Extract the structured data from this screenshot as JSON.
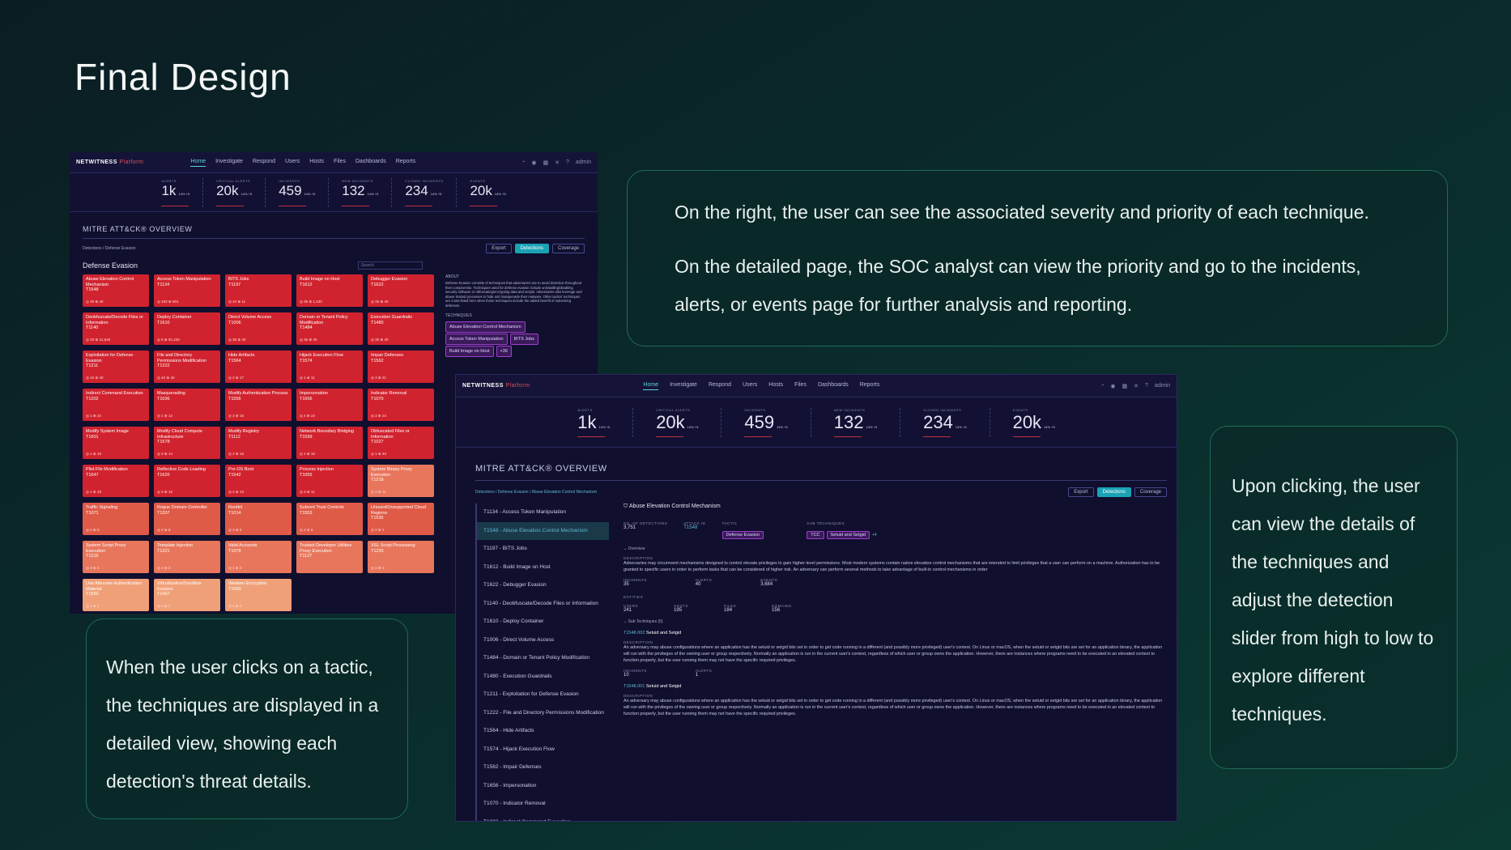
{
  "slide": {
    "title": "Final Design",
    "note_top_right": {
      "p1": "On the right, the user can see the associated severity and priority of each technique.",
      "p2": "On the detailed page, the SOC analyst can view the priority and go to the incidents, alerts, or events page for further analysis and reporting."
    },
    "note_bottom_left": "When the user clicks on a tactic, the techniques are displayed in a detailed view, showing each detection's threat details.",
    "note_right": "Upon clicking, the user can view the details of the techniques and adjust the detection slider from high to low to explore different techniques."
  },
  "app": {
    "logo": "NETWITNESS",
    "platform": "Platform",
    "nav": [
      "Home",
      "Investigate",
      "Respond",
      "Users",
      "Hosts",
      "Files",
      "Dashboards",
      "Reports"
    ],
    "user": "admin",
    "stats": [
      {
        "label": "ALERTS",
        "value": "1k",
        "delta": "14% +5"
      },
      {
        "label": "CRITICAL ALERTS",
        "value": "20k",
        "delta": "14% +5"
      },
      {
        "label": "INCIDENTS",
        "value": "459",
        "delta": "14% +5"
      },
      {
        "label": "NEW INCIDENTS",
        "value": "132",
        "delta": "14% +5"
      },
      {
        "label": "CLOSED INCIDENTS",
        "value": "234",
        "delta": "14% +5"
      },
      {
        "label": "EVENTS",
        "value": "20k",
        "delta": "14% +5"
      }
    ],
    "section_title": "MITRE ATT&CK® OVERVIEW",
    "export": "Export",
    "detections": "Detections",
    "coverage": "Coverage"
  },
  "screen1": {
    "breadcrumb": "Detections / Defense Evasion",
    "heading": "Defense Evasion",
    "search_placeholder": "Search",
    "about_label": "ABOUT",
    "about_text": "Defense Evasion consists of techniques that adversaries use to avoid detection throughout their compromise. Techniques used for defense evasion include uninstalling/disabling security software or obfuscating/encrypting data and scripts. Adversaries also leverage and abuse trusted processes to hide and masquerade their malware. Other tactics' techniques are cross-listed here when those techniques include the added benefit of subverting defenses.",
    "techniques_label": "TECHNIQUES",
    "technique_tags": [
      "Abuse Elevation Control Mechanism",
      "Access Token Manipulation",
      "BITS Jobs",
      "Build Image on Host",
      "+39"
    ],
    "cells": [
      {
        "name": "Abuse Elevation Control Mechanism",
        "id": "T1548",
        "m": "◎ 35 ⊕ 40",
        "c": "r1"
      },
      {
        "name": "Access Token Manipulation",
        "id": "T1134",
        "m": "◎ 183 ⊕ 501",
        "c": "r1"
      },
      {
        "name": "BITS Jobs",
        "id": "T1197",
        "m": "◎ 42 ⊕ 11",
        "c": "r1"
      },
      {
        "name": "Build Image on Host",
        "id": "T1612",
        "m": "◎ 35 ⊕ 1,430",
        "c": "r1"
      },
      {
        "name": "Debugger Evasion",
        "id": "T1622",
        "m": "◎ 35 ⊕ 40",
        "c": "r1"
      },
      {
        "name": "Deobfuscate/Decode Files or Information",
        "id": "T1140",
        "m": "◎ 20 ⊕ 12,640",
        "c": "r1"
      },
      {
        "name": "Deploy Container",
        "id": "T1610",
        "m": "◎ 5 ⊕ 91,240",
        "c": "r1"
      },
      {
        "name": "Direct Volume Access",
        "id": "T1006",
        "m": "◎ 35 ⊕ 40",
        "c": "r1"
      },
      {
        "name": "Domain or Tenant Policy Modification",
        "id": "T1484",
        "m": "◎ 35 ⊕ 40",
        "c": "r1"
      },
      {
        "name": "Execution Guardrails",
        "id": "T1480",
        "m": "◎ 35 ⊕ 40",
        "c": "r1"
      },
      {
        "name": "Exploitation for Defense Evasion",
        "id": "T1211",
        "m": "◎ 15 ⊕ 40",
        "c": "r1"
      },
      {
        "name": "File and Directory Permissions Modification",
        "id": "T1222",
        "m": "◎ 42 ⊕ 40",
        "c": "r1"
      },
      {
        "name": "Hide Artifacts",
        "id": "T1564",
        "m": "◎ 2 ⊕ 17",
        "c": "r1"
      },
      {
        "name": "Hijack Execution Flow",
        "id": "T1574",
        "m": "◎ 1 ⊕ 11",
        "c": "r1"
      },
      {
        "name": "Impair Defenses",
        "id": "T1562",
        "m": "◎ 3 ⊕ 21",
        "c": "r1"
      },
      {
        "name": "Indirect Command Execution",
        "id": "T1202",
        "m": "◎ 1 ⊕ 24",
        "c": "r1"
      },
      {
        "name": "Masquerading",
        "id": "T1036",
        "m": "◎ 1 ⊕ 12",
        "c": "r1"
      },
      {
        "name": "Modify Authentication Process",
        "id": "T1556",
        "m": "◎ 3 ⊕ 16",
        "c": "r1"
      },
      {
        "name": "Impersonation",
        "id": "T1656",
        "m": "◎ 4 ⊕ 22",
        "c": "r1"
      },
      {
        "name": "Indicator Removal",
        "id": "T1070",
        "m": "◎ 3 ⊕ 24",
        "c": "r1"
      },
      {
        "name": "Modify System Image",
        "id": "T1601",
        "m": "◎ 1 ⊕ 16",
        "c": "r1"
      },
      {
        "name": "Modify Cloud Compute Infrastructure",
        "id": "T1578",
        "m": "◎ 3 ⊕ 14",
        "c": "r1"
      },
      {
        "name": "Modify Registry",
        "id": "T1112",
        "m": "◎ 2 ⊕ 15",
        "c": "r1"
      },
      {
        "name": "Network Boundary Bridging",
        "id": "T1599",
        "m": "◎ 1 ⊕ 10",
        "c": "r1"
      },
      {
        "name": "Obfuscated Files or Information",
        "id": "T1027",
        "m": "◎ 1 ⊕ 40",
        "c": "r1"
      },
      {
        "name": "Plist File Modification",
        "id": "T1647",
        "m": "◎ 1 ⊕ 18",
        "c": "r1"
      },
      {
        "name": "Reflective Code Loading",
        "id": "T1620",
        "m": "◎ 3 ⊕ 16",
        "c": "r1"
      },
      {
        "name": "Pre-OS Boot",
        "id": "T1542",
        "m": "◎ 2 ⊕ 13",
        "c": "r1"
      },
      {
        "name": "Process Injection",
        "id": "T1055",
        "m": "◎ 3 ⊕ 11",
        "c": "r1"
      },
      {
        "name": "System Binary Proxy Execution",
        "id": "T1218",
        "m": "◎ 3 ⊕ 11",
        "c": "r4"
      },
      {
        "name": "Traffic Signaling",
        "id": "T1071",
        "m": "◎ 2 ⊕ 9",
        "c": "r3"
      },
      {
        "name": "Rogue Domain Controller",
        "id": "T1207",
        "m": "◎ 2 ⊕ 8",
        "c": "r3"
      },
      {
        "name": "Rootkit",
        "id": "T1014",
        "m": "◎ 2 ⊕ 5",
        "c": "r3"
      },
      {
        "name": "Subvert Trust Controls",
        "id": "T1553",
        "m": "◎ 2 ⊕ 6",
        "c": "r3"
      },
      {
        "name": "Unused/Unsupported Cloud Regions",
        "id": "T1535",
        "m": "◎ 2 ⊕ 1",
        "c": "r3"
      },
      {
        "name": "System Script Proxy Execution",
        "id": "T1216",
        "m": "◎ 2 ⊕ 3",
        "c": "r4"
      },
      {
        "name": "Template Injection",
        "id": "T1221",
        "m": "◎ 2 ⊕ 3",
        "c": "r4"
      },
      {
        "name": "Valid Accounts",
        "id": "T1078",
        "m": "◎ 1 ⊕ 2",
        "c": "r4"
      },
      {
        "name": "Trusted Developer Utilities Proxy Execution",
        "id": "T1127",
        "m": "",
        "c": "r4"
      },
      {
        "name": "XSL Script Processing",
        "id": "T1220",
        "m": "◎ 2 ⊕ 1",
        "c": "r4"
      },
      {
        "name": "Use Alternate Authentication Material",
        "id": "T1550",
        "m": "◎ 1 ⊕ 1",
        "c": "r5"
      },
      {
        "name": "Virtualization/Sandbox Evasion",
        "id": "T1497",
        "m": "◎ 1 ⊕ 1",
        "c": "r5"
      },
      {
        "name": "Weaken Encryption",
        "id": "T1600",
        "m": "◎ 1 ⊕ 1",
        "c": "r5"
      }
    ]
  },
  "screen2": {
    "breadcrumb": "Detections / Defense Evasion / Abuse Elevation Control Mechanism",
    "list": [
      "T1134 - Access Token Manipulation",
      "T1548 - Abuse Elevation Control Mechanism",
      "T1197 - BITS Jobs",
      "T1612 - Build Image on Host",
      "T1622 - Debugger Evasion",
      "T1140 - Deobfuscate/Decode Files or Information",
      "T1610 - Deploy Container",
      "T1006 - Direct Volume Access",
      "T1484 - Domain or Tenant Policy Modification",
      "T1480 - Execution Guardrails",
      "T1211 - Exploitation for Defense Evasion",
      "T1222 - File and Directory Permissions Modification",
      "T1564 - Hide Artifacts",
      "T1574 - Hijack Execution Flow",
      "T1562 - Impair Defenses",
      "T1656 - Impersonation",
      "T1070 - Indicator Removal",
      "T1202 - Indirect Command Execution"
    ],
    "detail_title": "Abuse Elevation Control Mechanism",
    "no_detections_label": "NO. OF DETECTIONS",
    "no_detections": "3,751",
    "attack_id_label": "ATTACK ID",
    "attack_id": "T1548",
    "tactic_label": "TACTIC",
    "tactic": "Defense Evasion",
    "sub_label": "SUB TECHNIQUES",
    "sub_tags": [
      "TCC",
      "Setuid and Setgid"
    ],
    "sub_more": "+4",
    "overview": "Overview",
    "description_label": "DESCRIPTION",
    "description": "Adversaries may circumvent mechanisms designed to control elevate privileges to gain higher-level permissions. Most modern systems contain native elevation control mechanisms that are intended to limit privileges that a user can perform on a machine. Authorization has to be granted to specific users in order to perform tasks that can be considered of higher risk. An adversary can perform several methods to take advantage of built-in control mechanisms in order",
    "incidents_label": "INCIDENTS",
    "incidents": "35",
    "alerts_label": "ALERTS",
    "alerts": "40",
    "events_label": "EVENTS",
    "events": "3,684",
    "entities_label": "ENTITIES",
    "users_label": "USERS",
    "users": "241",
    "hosts_label": "HOSTS",
    "hosts": "195",
    "files_label": "FILES",
    "files": "184",
    "domains_label": "DOMAINS",
    "domains": "156",
    "sub_techniques": "Sub Techniques (6)",
    "sub1_id": "T1548.002",
    "sub1_name": "Setuid and Setgid",
    "sub1_desc": "An adversary may abuse configurations where an application has the setuid or setgid bits set in order to get code running in a different (and possibly more privileged) user's context. On Linux or macOS, when the setuid or setgid bits are set for an application binary, the application will run with the privileges of the owning user or group respectively. Normally an application is run in the current user's context, regardless of which user or group owns the application. However, there are instances where programs need to be executed in an elevated context to function properly, but the user running them may not have the specific required privileges.",
    "sub1_incidents": "10",
    "sub1_alerts": "1",
    "sub2_id": "T1548.001",
    "sub2_name": "Setuid and Setgid",
    "sub2_desc": "An adversary may abuse configurations where an application has the setuid or setgid bits set in order to get code running in a different (and possibly more privileged) user's context. On Linux or macOS, when the setuid or setgid bits are set for an application binary, the application will run with the privileges of the owning user or group respectively. Normally an application is run in the current user's context, regardless of which user or group owns the application. However, there are instances where programs need to be executed in an elevated context to function properly, but the user running them may not have the specific required privileges."
  },
  "colors": {
    "accent": "#1aa3b5",
    "critical": "#d1232f",
    "note_border": "#1f6b55"
  }
}
